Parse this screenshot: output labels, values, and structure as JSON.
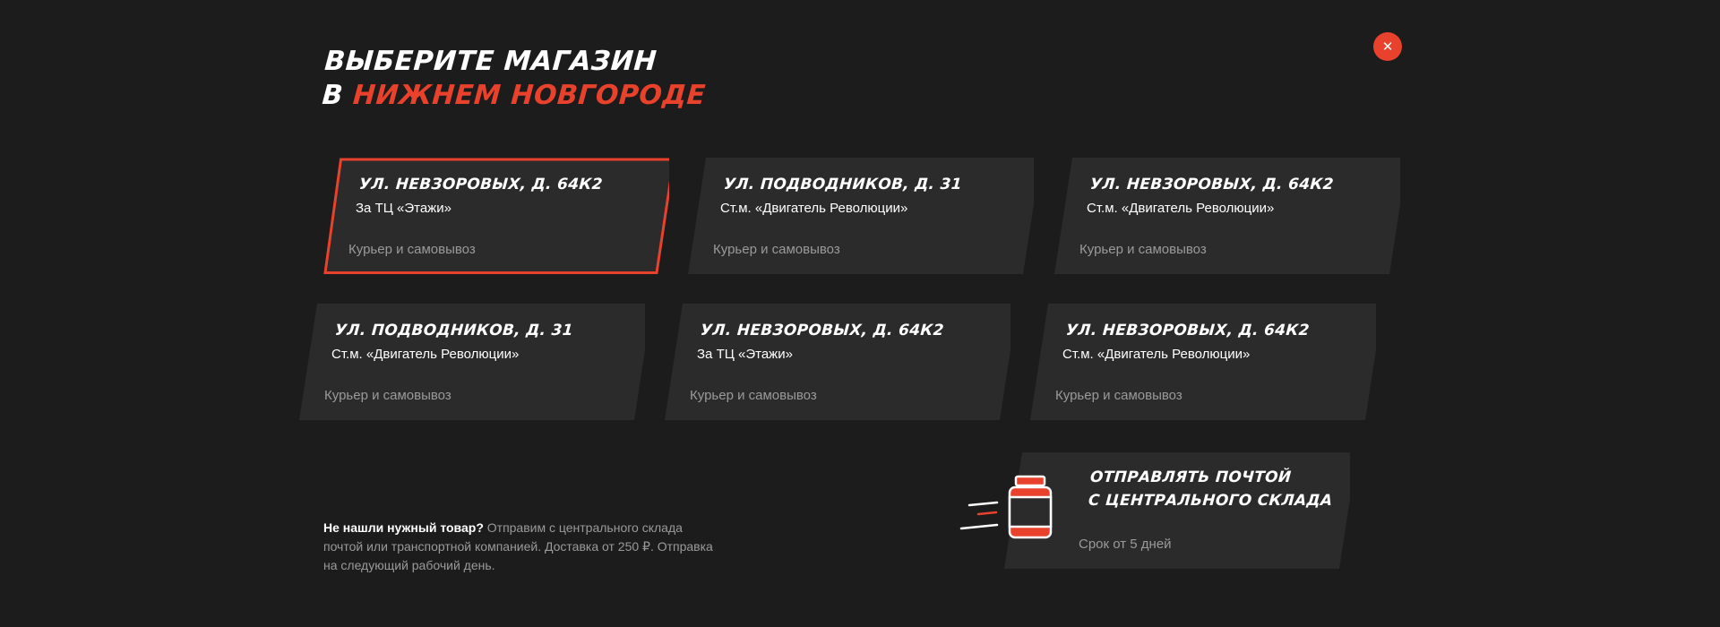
{
  "modal": {
    "title_line1": "ВЫБЕРИТЕ МАГАЗИН",
    "title_prefix": "В",
    "title_city": "НИЖНЕМ НОВГОРОДЕ",
    "close_label": "✕"
  },
  "stores": [
    {
      "name": "УЛ. НЕВЗОРОВЫХ, Д. 64К2",
      "landmark": "За ТЦ «Этажи»",
      "delivery": "Курьер и самовывоз",
      "selected": true
    },
    {
      "name": "УЛ. ПОДВОДНИКОВ, Д. 31",
      "landmark": "Ст.м. «Двигатель Революции»",
      "delivery": "Курьер и самовывоз",
      "selected": false
    },
    {
      "name": "УЛ. НЕВЗОРОВЫХ, Д. 64К2",
      "landmark": "Ст.м. «Двигатель Революции»",
      "delivery": "Курьер и самовывоз",
      "selected": false
    },
    {
      "name": "УЛ. ПОДВОДНИКОВ, Д. 31",
      "landmark": "Ст.м. «Двигатель Революции»",
      "delivery": "Курьер и самовывоз",
      "selected": false
    },
    {
      "name": "УЛ. НЕВЗОРОВЫХ, Д. 64К2",
      "landmark": "За ТЦ «Этажи»",
      "delivery": "Курьер и самовывоз",
      "selected": false
    },
    {
      "name": "УЛ. НЕВЗОРОВЫХ, Д. 64К2",
      "landmark": "Ст.м. «Двигатель Революции»",
      "delivery": "Курьер и самовывоз",
      "selected": false
    }
  ],
  "note": {
    "bold": "Не нашли нужный товар?",
    "text": " Отправим с центрального склада почтой или транспортной компанией. Доставка от 250 ₽. Отправка на следующий рабочий день."
  },
  "post_card": {
    "line1": "ОТПРАВЛЯТЬ ПОЧТОЙ",
    "line2": "С ЦЕНТРАЛЬНОГО СКЛАДА",
    "term": "Срок от 5 дней",
    "icon": "jar-icon"
  },
  "colors": {
    "background": "#1c1c1c",
    "card": "#2b2b2b",
    "accent": "#e8412c",
    "muted_text": "#9a9a9a"
  }
}
